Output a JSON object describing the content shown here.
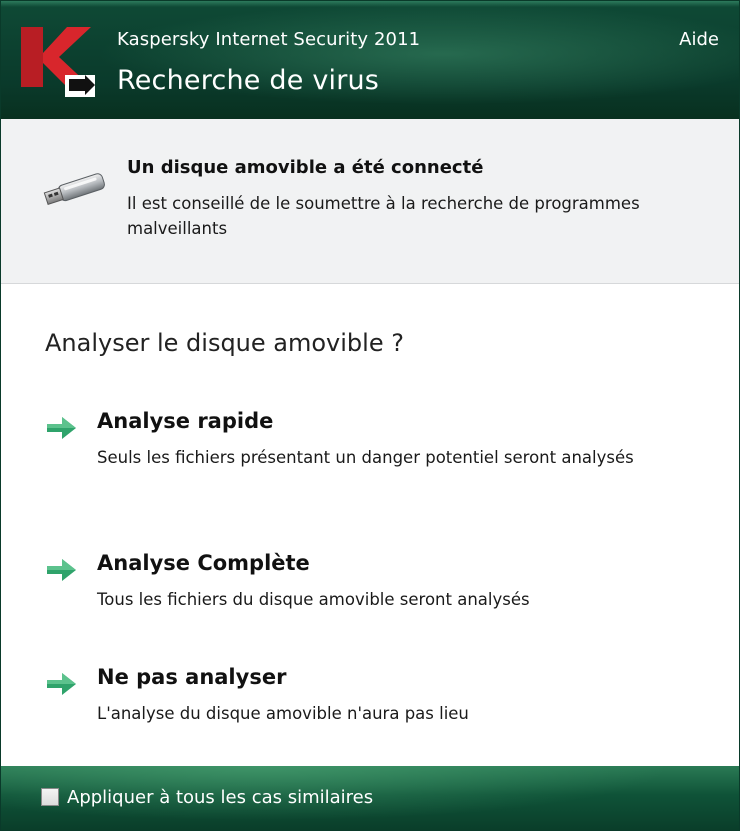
{
  "header": {
    "app_name": "Kaspersky Internet Security 2011",
    "title": "Recherche de virus",
    "help_label": "Aide",
    "logo_icon": "kaspersky-k-logo"
  },
  "notice": {
    "icon": "usb-drive-icon",
    "title": "Un disque amovible a été connecté",
    "text": "Il est conseillé de le soumettre à la recherche de programmes malveillants"
  },
  "main": {
    "question": "Analyser le disque amovible ?",
    "options": [
      {
        "icon": "arrow-right-icon",
        "title": "Analyse rapide",
        "description": "Seuls les fichiers présentant un danger potentiel seront analysés"
      },
      {
        "icon": "arrow-right-icon",
        "title": "Analyse Complète",
        "description": "Tous les fichiers du disque amovible seront analysés"
      },
      {
        "icon": "arrow-right-icon",
        "title": "Ne pas analyser",
        "description": "L'analyse du disque amovible n'aura pas lieu"
      }
    ]
  },
  "footer": {
    "checkbox_label": "Appliquer à tous les cas similaires",
    "checked": false
  },
  "colors": {
    "header_green": "#0a3a2b",
    "footer_green": "#0f5338",
    "arrow_green": "#2fa36b",
    "logo_red": "#d8262c"
  }
}
